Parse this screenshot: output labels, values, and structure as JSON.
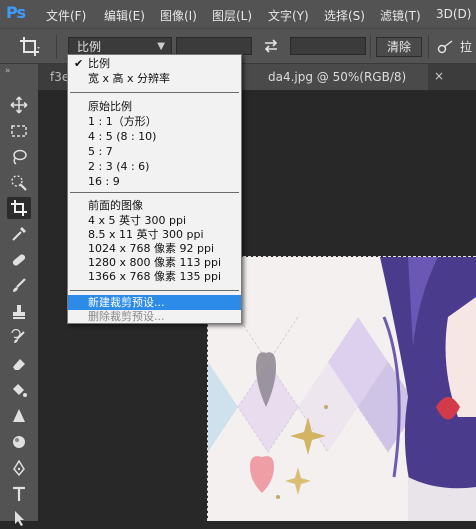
{
  "app": {
    "logo": "Ps"
  },
  "menu": [
    "文件(F)",
    "编辑(E)",
    "图像(I)",
    "图层(L)",
    "文字(Y)",
    "选择(S)",
    "滤镜(T)",
    "3D(D)"
  ],
  "options": {
    "ratio_value": "比例",
    "clear_label": "清除",
    "straighten_label": "拉"
  },
  "tabs": {
    "left_partial": "f3e",
    "active_title": "da4.jpg @ 50%(RGB/8)",
    "close": "×"
  },
  "dropdown": {
    "group1": [
      "比例",
      "宽 x 高 x 分辨率"
    ],
    "group2": [
      "原始比例",
      "1 : 1（方形）",
      "4 : 5 (8 : 10)",
      "5 : 7",
      "2 : 3 (4 : 6)",
      "16 : 9"
    ],
    "group3": [
      "前面的图像",
      "4 x 5 英寸 300 ppi",
      "8.5 x 11 英寸 300 ppi",
      "1024 x 768 像素 92 ppi",
      "1280 x 800 像素 113 ppi",
      "1366 x 768 像素 135 ppi"
    ],
    "group4": [
      "新建裁剪预设...",
      "删除裁剪预设..."
    ],
    "checked": "比例",
    "highlighted": "新建裁剪预设..."
  },
  "colors": {
    "accent": "#2c8be8",
    "ps_blue": "#3d9bff"
  }
}
